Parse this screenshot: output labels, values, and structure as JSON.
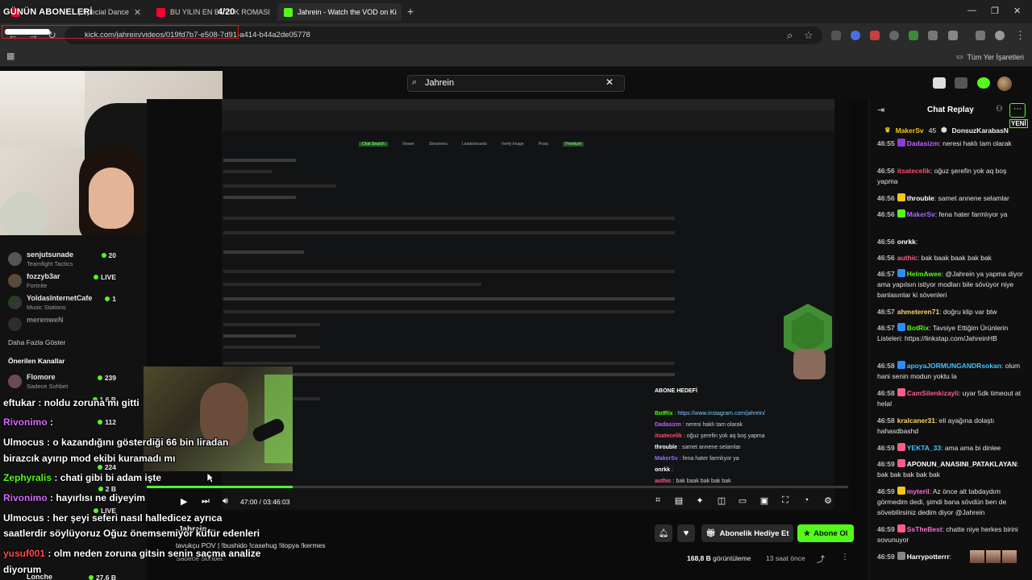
{
  "browser": {
    "tabs": [
      {
        "title": "| Special Dance",
        "close": "✕"
      },
      {
        "title": "BU YILIN EN BÜYÜK ROMASI",
        "close": "✕"
      },
      {
        "title": "Jahrein - Watch the VOD on Ki",
        "close": "✕"
      }
    ],
    "new_tab": "+",
    "url": "kick.com/jahrein/videos/019fd7b7-e508-7d91-a414-b44a2de05778",
    "bookmarks_label": "Tüm Yer İşaretleri"
  },
  "overlay": {
    "title": "GÜNÜN ABONELERİ",
    "count": "4/20"
  },
  "header": {
    "search_value": "Jahrein"
  },
  "sidebar": {
    "channels_top": [
      {
        "name": "",
        "game": "Sadece Sohbet",
        "viewers": ""
      },
      {
        "name": "senjutsunade",
        "game": "Teamfight Tactics",
        "viewers": "20"
      },
      {
        "name": "fozzyb3ar",
        "game": "Fortnite",
        "viewers": "LIVE"
      },
      {
        "name": "YoldasInternetCafe",
        "game": "Music Stations",
        "viewers": "1"
      },
      {
        "name": "merenweN",
        "game": "",
        "viewers": ""
      }
    ],
    "show_more": "Daha Fazla Göster",
    "recommended_title": "Önerilen Kanallar",
    "recommended": [
      {
        "name": "Flomore",
        "game": "Sadece Sohbet",
        "viewers": "239"
      },
      {
        "name": "Swaggybark",
        "game": "",
        "viewers": "1.6 B"
      },
      {
        "name": "",
        "game": "",
        "viewers": "112"
      },
      {
        "name": "",
        "game": "Teamfight Tactics",
        "viewers": ""
      },
      {
        "name": "",
        "game": "Dota 2",
        "viewers": ""
      },
      {
        "name": "Azdus",
        "game": "",
        "viewers": "224"
      },
      {
        "name": "EimiiloR",
        "game": "",
        "viewers": "2 B"
      },
      {
        "name": "ovotz",
        "game": "",
        "viewers": "LIVE"
      },
      {
        "name": "",
        "game": "Big Walk",
        "viewers": ""
      },
      {
        "name": "",
        "game": "IRL",
        "viewers": ""
      },
      {
        "name": "Lonche",
        "game": "",
        "viewers": "27.6 B"
      }
    ]
  },
  "video": {
    "time_current": "47:00",
    "time_total": "03:46:03",
    "progress": 0.2078,
    "streamer": "Jahrein",
    "title": "tavukçu POV | !bushido !casehug !itopya !kermes",
    "category": "Sadece Sohbet"
  },
  "overlay_chat": [
    {
      "user": "eftukar",
      "text": " : noldu zoruna mı gitti",
      "color": "#ffffff"
    },
    {
      "user": "Rivonimo",
      "text": " : ",
      "color": "#d36bff"
    },
    {
      "user": "Ulmocus",
      "text": " : o kazandığını gösterdiği 66 bin liradan",
      "color": "#ffffff"
    },
    {
      "user": "",
      "text": "birazcık ayırıp mod ekibi kuramadı mı",
      "color": "#ffffff"
    },
    {
      "user": "Zephyralis",
      "text": " : chati gibi bi adam işte",
      "color": "#53fc18"
    },
    {
      "user": "Rivonimo",
      "text": " : hayırlısı ne diyeyim",
      "color": "#d36bff"
    },
    {
      "user": "Ulmocus",
      "text": " : her şeyi seferi nasıl halledicez ayrıca",
      "color": "#ffffff"
    },
    {
      "user": "",
      "text": "saatlerdir söylüyoruz Oğuz önemsemiyor küfür edenleri",
      "color": "#ffffff"
    },
    {
      "user": "yusuf001",
      "text": " : olm neden zoruna gitsin senin saçma analize",
      "color": "#ff4b4b"
    },
    {
      "user": "",
      "text": "diyorum",
      "color": "#ffffff"
    }
  ],
  "embedded_chat": [
    {
      "user": "BotRix",
      "text": ": https://www.instagram.com/jahrein/"
    },
    {
      "user": "Dadasizm",
      "text": ": neresi haklı tam olarak"
    },
    {
      "user": "itsatecelik",
      "text": ": oğuz şerefin yok aq boş yapma"
    },
    {
      "user": "throuble",
      "text": ": samet annene selamlar"
    },
    {
      "user": "MakerSv",
      "text": ": fena hater farmlıyor ya"
    },
    {
      "user": "onrkk",
      "text": ":"
    },
    {
      "user": "authic",
      "text": ": bak baak bak bak bak"
    }
  ],
  "embedded_sub_label": "ABONE HEDEFİ",
  "actions": {
    "gift_label": "Abonelik Hediye Et",
    "sub_label": "Abone Ol",
    "views": "168,8 B",
    "views_label": "görüntüleme",
    "ago": "13 saat önce"
  },
  "chat": {
    "title": "Chat Replay",
    "new_label": "YENİ",
    "pinned": [
      {
        "user": "MakerSv",
        "count": "45",
        "color": "#f5c518"
      },
      {
        "user": "DonsuzKarabasN",
        "count": "",
        "color": "#f0f0f0"
      }
    ],
    "messages": [
      {
        "time": "46:55",
        "user": "Dadasizm",
        "color": "#c060ff",
        "badge": "#8e3bd1",
        "text": ": neresi haklı tam olarak"
      },
      {
        "time": "46:56",
        "user": "itsatecelik",
        "color": "#ff4f6b",
        "badge": "",
        "text": ": oğuz şerefin yok aq boş yapma"
      },
      {
        "time": "46:56",
        "user": "throuble",
        "color": "#ffffff",
        "badge": "#f5c518",
        "text": ": samet annene selamlar"
      },
      {
        "time": "46:56",
        "user": "MakerSv",
        "color": "#a06bff",
        "badge": "#53fc18",
        "text": ": fena hater farmlıyor ya"
      },
      {
        "time": "46:56",
        "user": "onrkk",
        "color": "#ffffff",
        "badge": "",
        "text": ":"
      },
      {
        "time": "46:56",
        "user": "authic",
        "color": "#ff5c8a",
        "badge": "",
        "text": ": bak baak baak bak bak"
      },
      {
        "time": "46:57",
        "user": "HelmAwee",
        "color": "#53fc18",
        "badge": "#2d8cff",
        "text": ": @Jahrein ya yapma diyor ama yapılsın istiyor modları bile sövüyor niye banlasınlar ki sövenleri"
      },
      {
        "time": "46:57",
        "user": "ahmeteren71",
        "color": "#ffd166",
        "badge": "",
        "text": ": doğru klip var btw"
      },
      {
        "time": "46:57",
        "user": "BotRix",
        "color": "#53fc18",
        "badge": "#2d8cff",
        "text": ": Tavsiye Ettiğim Ürünlerin Listeleri: https://linkstap.com/JahreinHB"
      },
      {
        "time": "46:58",
        "user": "apoyaJORMUNGANDRsokan",
        "color": "#40c4ff",
        "badge": "#2d8cff",
        "text": ": olum hani senin modun yoktu la"
      },
      {
        "time": "46:58",
        "user": "CamSilenkizayli",
        "color": "#ff5c8a",
        "badge": "#ff5c8a",
        "text": ": uyar 5dk timeout at helal"
      },
      {
        "time": "46:58",
        "user": "kralcaner31",
        "color": "#ffd166",
        "badge": "",
        "text": ": eli ayağına dolaştı hahasdbashd"
      },
      {
        "time": "46:59",
        "user": "YEKTA_33",
        "color": "#40c4ff",
        "badge": "#ff5c8a",
        "text": ": ama ama bi dinlee"
      },
      {
        "time": "46:59",
        "user": "APONUN_ANASINI_PATAKLAYAN",
        "color": "#ffffff",
        "badge": "#ff5c8a",
        "text": ": bak bak bak bak bak"
      },
      {
        "time": "46:59",
        "user": "myteril",
        "color": "#ff6bd6",
        "badge": "#f5c518",
        "text": ": Az önce alt tabdaydım görmedim dedi, şimdi bana sövdün ben de sövebilirsiniz dedim diyor @Jahrein"
      },
      {
        "time": "46:59",
        "user": "SsTheBest",
        "color": "#ff6bd6",
        "badge": "#ff5c8a",
        "text": ": chatte niye herkes birini sovunuyor"
      },
      {
        "time": "46:59",
        "user": "Harrypotterrr",
        "color": "#ffffff",
        "badge": "#888888",
        "text": ":"
      }
    ]
  },
  "colors": {
    "accent": "#53fc18",
    "chat_bg": "#0f0f0f",
    "page_bg": "#0b0b0b"
  }
}
